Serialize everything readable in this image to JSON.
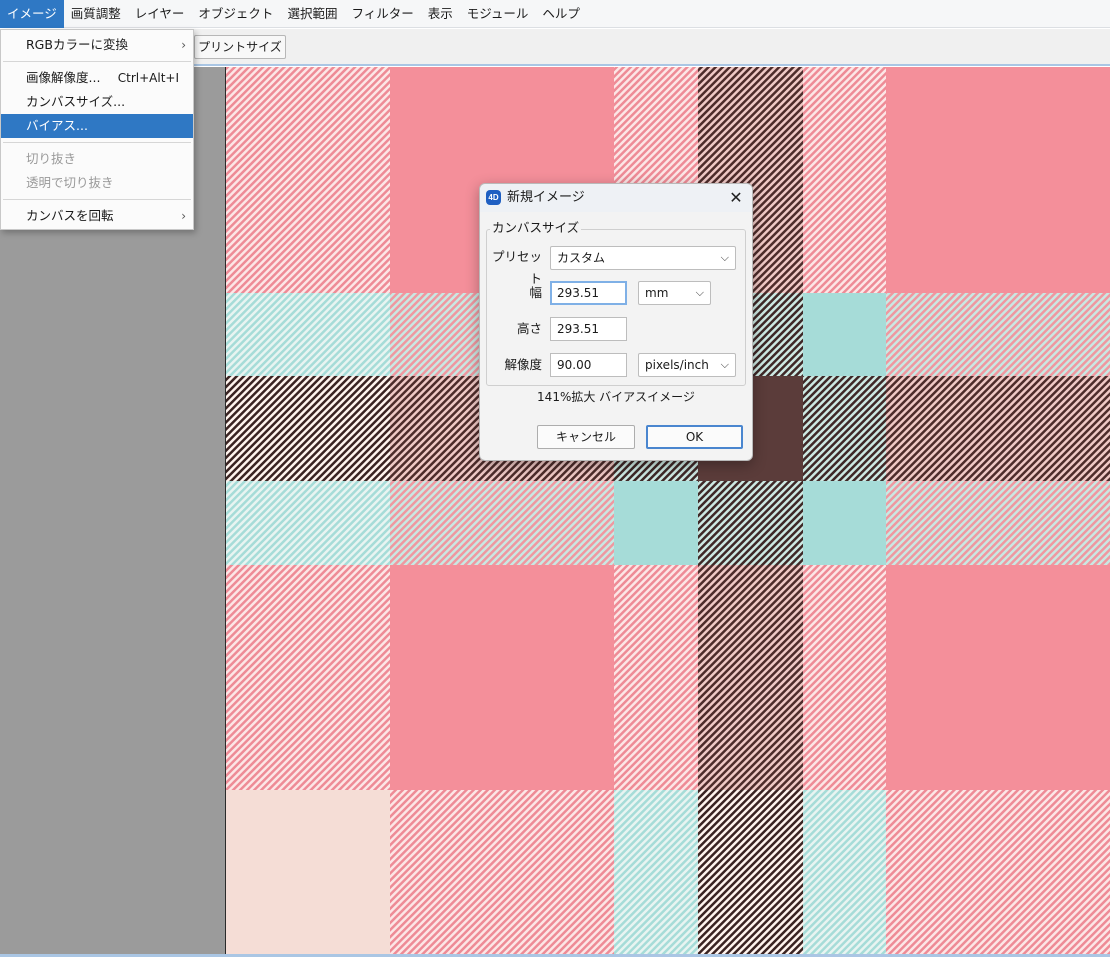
{
  "menubar": {
    "items": [
      "イメージ",
      "画質調整",
      "レイヤー",
      "オブジェクト",
      "選択範囲",
      "フィルター",
      "表示",
      "モジュール",
      "ヘルプ"
    ],
    "active_index": 0
  },
  "toolbar": {
    "print_size_label": "プリントサイズ"
  },
  "image_menu": {
    "items": [
      {
        "label": "RGBカラーに変換",
        "shortcut": "",
        "submenu": true,
        "disabled": false,
        "highlighted": false
      },
      {
        "label": "画像解像度...",
        "shortcut": "Ctrl+Alt+I",
        "submenu": false,
        "disabled": false,
        "highlighted": false
      },
      {
        "label": "カンバスサイズ...",
        "shortcut": "",
        "submenu": false,
        "disabled": false,
        "highlighted": false
      },
      {
        "label": "バイアス...",
        "shortcut": "",
        "submenu": false,
        "disabled": false,
        "highlighted": true
      },
      {
        "label": "切り抜き",
        "shortcut": "",
        "submenu": false,
        "disabled": true,
        "highlighted": false
      },
      {
        "label": "透明で切り抜き",
        "shortcut": "",
        "submenu": false,
        "disabled": true,
        "highlighted": false
      },
      {
        "label": "カンバスを回転",
        "shortcut": "",
        "submenu": true,
        "disabled": false,
        "highlighted": false
      }
    ],
    "submenu_arrow": "›"
  },
  "dialog": {
    "app_icon_text": "4D",
    "title": "新規イメージ",
    "close_glyph": "✕",
    "group_label": "カンバスサイズ",
    "preset": {
      "label": "プリセット",
      "value": "カスタム"
    },
    "width": {
      "label": "幅",
      "value": "293.51",
      "unit": "mm"
    },
    "height": {
      "label": "高さ",
      "value": "293.51"
    },
    "resolution": {
      "label": "解像度",
      "value": "90.00",
      "unit": "pixels/inch"
    },
    "info": "141%拡大 バイアスイメージ",
    "cancel_label": "キャンセル",
    "ok_label": "OK",
    "chevron_glyph": "⌵"
  },
  "colors": {
    "menu_highlight": "#2f78c4",
    "tartan_pink": "#f48f9a",
    "tartan_teal": "#a6dcd8",
    "tartan_brown": "#5b3c3a",
    "tartan_blush": "#f5ddd6",
    "workspace_gray": "#9b9b9b"
  }
}
